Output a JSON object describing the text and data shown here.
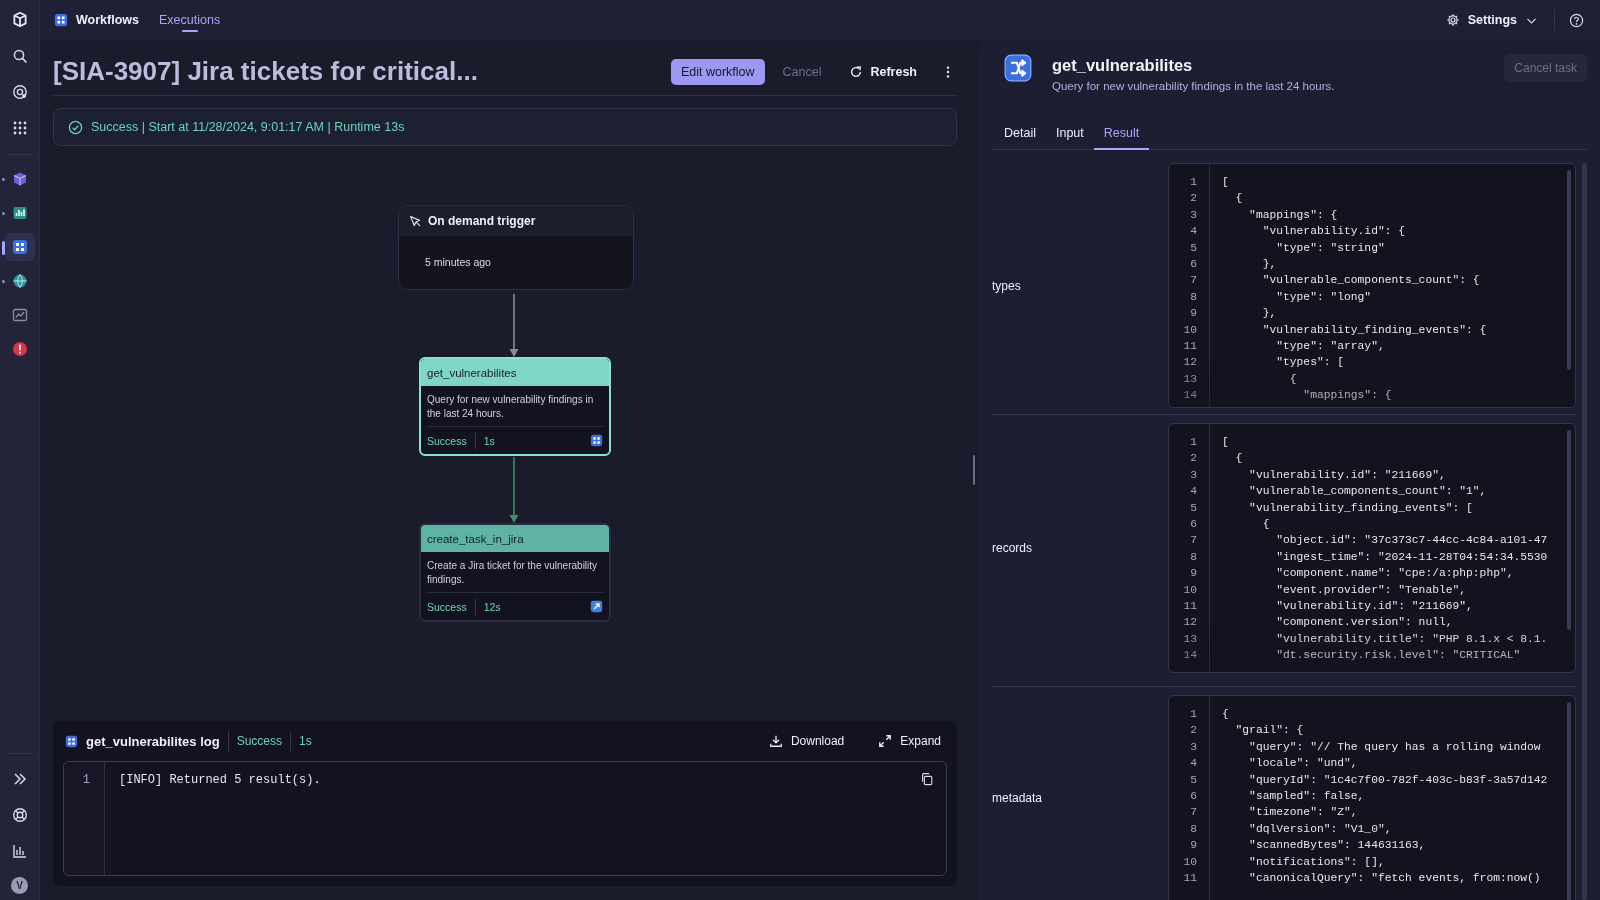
{
  "sidebar": {
    "nav": [
      {
        "kind": "logo",
        "selected": false
      },
      {
        "kind": "search",
        "selected": false
      },
      {
        "kind": "orbit",
        "selected": false
      },
      {
        "kind": "apps",
        "selected": false
      }
    ],
    "apps": [
      {
        "kind": "cube",
        "selected": false,
        "indicator": true
      },
      {
        "kind": "chart",
        "selected": false,
        "indicator": true
      },
      {
        "kind": "workflow",
        "selected": true,
        "indicator": false
      },
      {
        "kind": "globe",
        "selected": false,
        "indicator": true
      },
      {
        "kind": "dashboard",
        "selected": false,
        "indicator": false
      },
      {
        "kind": "alert",
        "selected": false,
        "indicator": false
      }
    ],
    "footer": [
      {
        "kind": "expand"
      },
      {
        "kind": "lifebuoy"
      },
      {
        "kind": "reports"
      }
    ],
    "avatar": "V"
  },
  "top_bar": {
    "app_title": "Workflows",
    "tabs": [
      {
        "label": "Executions",
        "selected": true
      }
    ],
    "settings_label": "Settings"
  },
  "header": {
    "title": "[SIA-3907] Jira tickets for critical...",
    "buttons": [
      {
        "label": "Edit workflow",
        "kind": "primary",
        "disabled": false
      },
      {
        "label": "Cancel",
        "kind": "plain",
        "disabled": true
      },
      {
        "label": "Refresh",
        "kind": "refresh",
        "disabled": false
      }
    ]
  },
  "status_banner": {
    "kind": "success",
    "text": "Success | Start at 11/28/2024, 9:01:17 AM | Runtime 13s"
  },
  "graph": {
    "trigger": {
      "title": "On demand trigger",
      "time": "5 minutes ago"
    },
    "tasks": [
      {
        "name": "get_vulnerabilites",
        "description": "Query for new vulnerability findings in the last 24 hours.",
        "status": "Success",
        "duration": "1s",
        "selected": true,
        "kind": "query"
      },
      {
        "name": "create_task_in_jira",
        "description": "Create a Jira ticket for the vulnerability findings.",
        "status": "Success",
        "duration": "12s",
        "selected": false,
        "kind": "jira"
      }
    ]
  },
  "log": {
    "title": "get_vulnerabilites log",
    "status": "Success",
    "duration": "1s",
    "actions": [
      {
        "label": "Download",
        "kind": "download"
      },
      {
        "label": "Expand",
        "kind": "expand"
      }
    ],
    "lines": [
      {
        "n": "1",
        "code": "[INFO] Returned 5 result(s)."
      }
    ]
  },
  "task_panel": {
    "title": "get_vulnerabilites",
    "description": "Query for new vulnerability findings in the last 24 hours.",
    "cancel_label": "Cancel task",
    "cancel_disabled": true,
    "tabs": [
      {
        "label": "Detail",
        "selected": false
      },
      {
        "label": "Input",
        "selected": false
      },
      {
        "label": "Result",
        "selected": true
      }
    ],
    "sections": [
      {
        "label": "types",
        "lines": [
          {
            "n": "1",
            "code": "["
          },
          {
            "n": "2",
            "code": "  {"
          },
          {
            "n": "3",
            "code": "    \"mappings\": {"
          },
          {
            "n": "4",
            "code": "      \"vulnerability.id\": {"
          },
          {
            "n": "5",
            "code": "        \"type\": \"string\""
          },
          {
            "n": "6",
            "code": "      },"
          },
          {
            "n": "7",
            "code": "      \"vulnerable_components_count\": {"
          },
          {
            "n": "8",
            "code": "        \"type\": \"long\""
          },
          {
            "n": "9",
            "code": "      },"
          },
          {
            "n": "10",
            "code": "      \"vulnerability_finding_events\": {"
          },
          {
            "n": "11",
            "code": "        \"type\": \"array\","
          },
          {
            "n": "12",
            "code": "        \"types\": ["
          },
          {
            "n": "13",
            "code": "          {"
          },
          {
            "n": "14",
            "code": "            \"mappings\": {"
          }
        ]
      },
      {
        "label": "records",
        "lines": [
          {
            "n": "1",
            "code": "["
          },
          {
            "n": "2",
            "code": "  {"
          },
          {
            "n": "3",
            "code": "    \"vulnerability.id\": \"211669\","
          },
          {
            "n": "4",
            "code": "    \"vulnerable_components_count\": \"1\","
          },
          {
            "n": "5",
            "code": "    \"vulnerability_finding_events\": ["
          },
          {
            "n": "6",
            "code": "      {"
          },
          {
            "n": "7",
            "code": "        \"object.id\": \"37c373c7-44cc-4c84-a101-47"
          },
          {
            "n": "8",
            "code": "        \"ingest_time\": \"2024-11-28T04:54:34.5530"
          },
          {
            "n": "9",
            "code": "        \"component.name\": \"cpe:/a:php:php\","
          },
          {
            "n": "10",
            "code": "        \"event.provider\": \"Tenable\","
          },
          {
            "n": "11",
            "code": "        \"vulnerability.id\": \"211669\","
          },
          {
            "n": "12",
            "code": "        \"component.version\": null,"
          },
          {
            "n": "13",
            "code": "        \"vulnerability.title\": \"PHP 8.1.x < 8.1."
          },
          {
            "n": "14",
            "code": "        \"dt.security.risk.level\": \"CRITICAL\""
          }
        ]
      },
      {
        "label": "metadata",
        "lines": [
          {
            "n": "1",
            "code": "{"
          },
          {
            "n": "2",
            "code": "  \"grail\": {"
          },
          {
            "n": "3",
            "code": "    \"query\": \"// The query has a rolling window"
          },
          {
            "n": "4",
            "code": "    \"locale\": \"und\","
          },
          {
            "n": "5",
            "code": "    \"queryId\": \"1c4c7f00-782f-403c-b83f-3a57d142"
          },
          {
            "n": "6",
            "code": "    \"sampled\": false,"
          },
          {
            "n": "7",
            "code": "    \"timezone\": \"Z\","
          },
          {
            "n": "8",
            "code": "    \"dqlVersion\": \"V1_0\","
          },
          {
            "n": "9",
            "code": "    \"scannedBytes\": 144631163,"
          },
          {
            "n": "10",
            "code": "    \"notifications\": [],"
          },
          {
            "n": "11",
            "code": "    \"canonicalQuery\": \"fetch events, from:now()"
          }
        ]
      }
    ]
  }
}
